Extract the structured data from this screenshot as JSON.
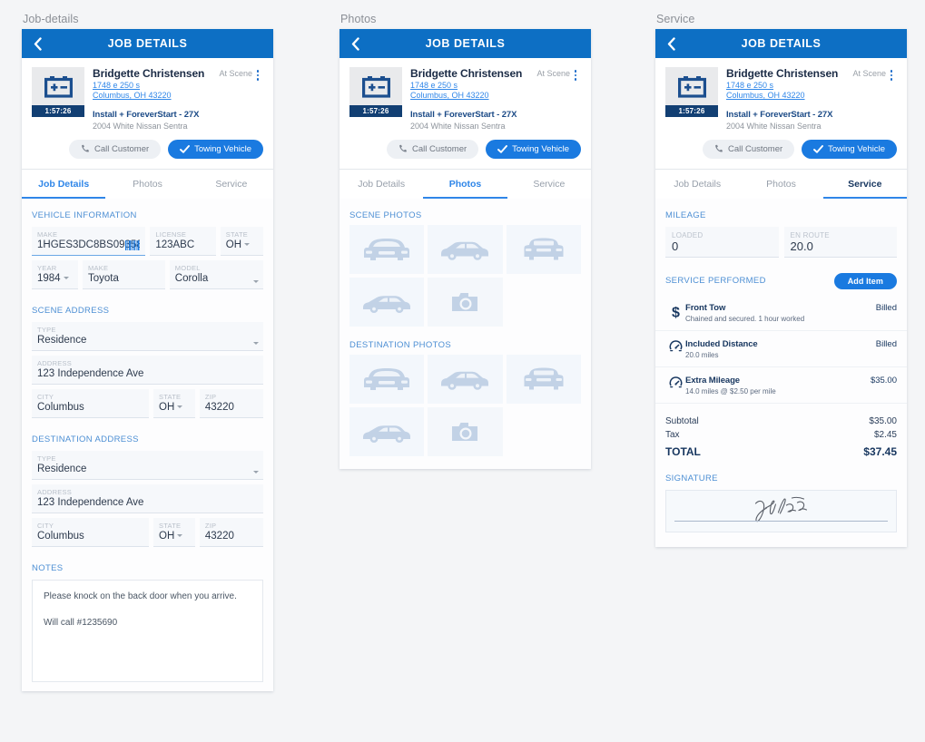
{
  "panels": [
    {
      "caption": "Job-details"
    },
    {
      "caption": "Photos"
    },
    {
      "caption": "Service"
    }
  ],
  "titlebar": {
    "title": "JOB DETAILS",
    "back_icon": "chevron-left-icon"
  },
  "job_card": {
    "thumb_icon": "battery-icon",
    "timer": "1:57:26",
    "customer_name": "Bridgette Christensen",
    "status": "At Scene",
    "menu_icon": "kebab-menu-icon",
    "address_line1": "1748 e 250 s",
    "address_line2": "Columbus, OH 43220",
    "service_code": "Install + ForeverStart - 27X",
    "vehicle_desc": "2004 White Nissan Sentra",
    "call_button": {
      "label": "Call Customer",
      "icon": "phone-icon"
    },
    "tow_button": {
      "label": "Towing Vehicle",
      "icon": "check-icon"
    }
  },
  "tabs": [
    {
      "label": "Job Details"
    },
    {
      "label": "Photos"
    },
    {
      "label": "Service"
    }
  ],
  "job_details": {
    "vehicle_information": {
      "title": "VEHICLE INFORMATION",
      "vin_field": {
        "label": "MAKE",
        "value": "1HGES3DC8BS093588",
        "icon": "barcode-icon"
      },
      "license_field": {
        "label": "LICENSE",
        "value": "123ABC"
      },
      "state_field": {
        "label": "STATE",
        "value": "OH"
      },
      "year_field": {
        "label": "YEAR",
        "value": "1984"
      },
      "make_field": {
        "label": "MAKE",
        "value": "Toyota"
      },
      "model_field": {
        "label": "MODEL",
        "value": "Corolla"
      }
    },
    "scene_address": {
      "title": "SCENE ADDRESS",
      "type_field": {
        "label": "TYPE",
        "value": "Residence"
      },
      "address_field": {
        "label": "ADDRESS",
        "value": "123 Independence Ave"
      },
      "city_field": {
        "label": "CITY",
        "value": "Columbus"
      },
      "state_field": {
        "label": "STATE",
        "value": "OH"
      },
      "zip_field": {
        "label": "ZIP",
        "value": "43220"
      }
    },
    "destination_address": {
      "title": "DESTINATION ADDRESS",
      "type_field": {
        "label": "TYPE",
        "value": "Residence"
      },
      "address_field": {
        "label": "ADDRESS",
        "value": "123 Independence Ave"
      },
      "city_field": {
        "label": "CITY",
        "value": "Columbus"
      },
      "state_field": {
        "label": "STATE",
        "value": "OH"
      },
      "zip_field": {
        "label": "ZIP",
        "value": "43220"
      }
    },
    "notes": {
      "title": "NOTES",
      "line1": "Please knock on the back door when you arrive.",
      "line2": "Will call #1235690"
    }
  },
  "photos": {
    "scene": {
      "title": "SCENE PHOTOS",
      "items": [
        {
          "icon": "car-front-icon"
        },
        {
          "icon": "car-side-icon"
        },
        {
          "icon": "car-rear-icon"
        },
        {
          "icon": "car-side-icon"
        },
        {
          "icon": "camera-icon"
        }
      ]
    },
    "destination": {
      "title": "DESTINATION PHOTOS",
      "items": [
        {
          "icon": "car-front-icon"
        },
        {
          "icon": "car-side-icon"
        },
        {
          "icon": "car-rear-icon"
        },
        {
          "icon": "car-side-icon"
        },
        {
          "icon": "camera-icon"
        }
      ]
    }
  },
  "service": {
    "mileage": {
      "title": "MILEAGE",
      "loaded": {
        "label": "LOADED",
        "value": "0"
      },
      "en_route": {
        "label": "EN ROUTE",
        "value": "20.0"
      }
    },
    "performed": {
      "title": "SERVICE PERFORMED",
      "add_item_label": "Add Item",
      "items": [
        {
          "icon": "dollar-icon",
          "name": "Front Tow",
          "desc": "Chained and secured. 1 hour worked",
          "amount": "Billed"
        },
        {
          "icon": "odometer-icon",
          "name": "Included Distance",
          "desc": "20.0 miles",
          "amount": "Billed"
        },
        {
          "icon": "odometer-icon",
          "name": "Extra Mileage",
          "desc": "14.0 miles @ $2.50 per mile",
          "amount": "$35.00"
        }
      ]
    },
    "totals": {
      "subtotal_label": "Subtotal",
      "subtotal_value": "$35.00",
      "tax_label": "Tax",
      "tax_value": "$2.45",
      "total_label": "TOTAL",
      "total_value": "$37.45"
    },
    "signature": {
      "title": "SIGNATURE",
      "mark": "signature-scribble"
    }
  },
  "colors": {
    "header_blue": "#0d6fc4",
    "accent_blue": "#1a7ae0",
    "link_blue": "#2f86e8",
    "navy": "#17365f",
    "timer_navy": "#123f73",
    "section_label": "#4d8fd4",
    "page_bg": "#f4f5f7",
    "photo_tile": "#f3f7fc",
    "photo_glyph": "#c2d2e6"
  }
}
